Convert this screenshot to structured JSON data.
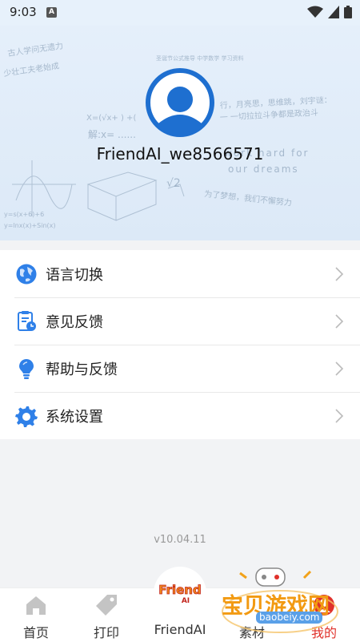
{
  "status": {
    "time": "9:03",
    "notif": "A"
  },
  "profile": {
    "username": "FriendAI_we8566571"
  },
  "menu": [
    {
      "label": "语言切换",
      "icon": "globe-icon",
      "color": "#2f80e8"
    },
    {
      "label": "意见反馈",
      "icon": "feedback-clipboard-icon",
      "color": "#2f80e8"
    },
    {
      "label": "帮助与反馈",
      "icon": "lightbulb-icon",
      "color": "#2f80e8"
    },
    {
      "label": "系统设置",
      "icon": "gear-icon",
      "color": "#2f80e8"
    }
  ],
  "version": "v10.04.11",
  "tabs": [
    {
      "label": "首页",
      "icon": "home-icon"
    },
    {
      "label": "打印",
      "icon": "tag-icon"
    },
    {
      "label": "FriendAI",
      "icon": "friendai-logo"
    },
    {
      "label": "素材",
      "icon": "material-icon"
    },
    {
      "label": "我的",
      "icon": "profile-icon",
      "active": true
    }
  ],
  "brand": {
    "logo_text": "Friend",
    "logo_sub": "AI",
    "accent": "#2f80e8",
    "active_tab": "#e0312b"
  },
  "watermark": {
    "text": "宝贝游戏网",
    "url": "baobeiy.com"
  }
}
